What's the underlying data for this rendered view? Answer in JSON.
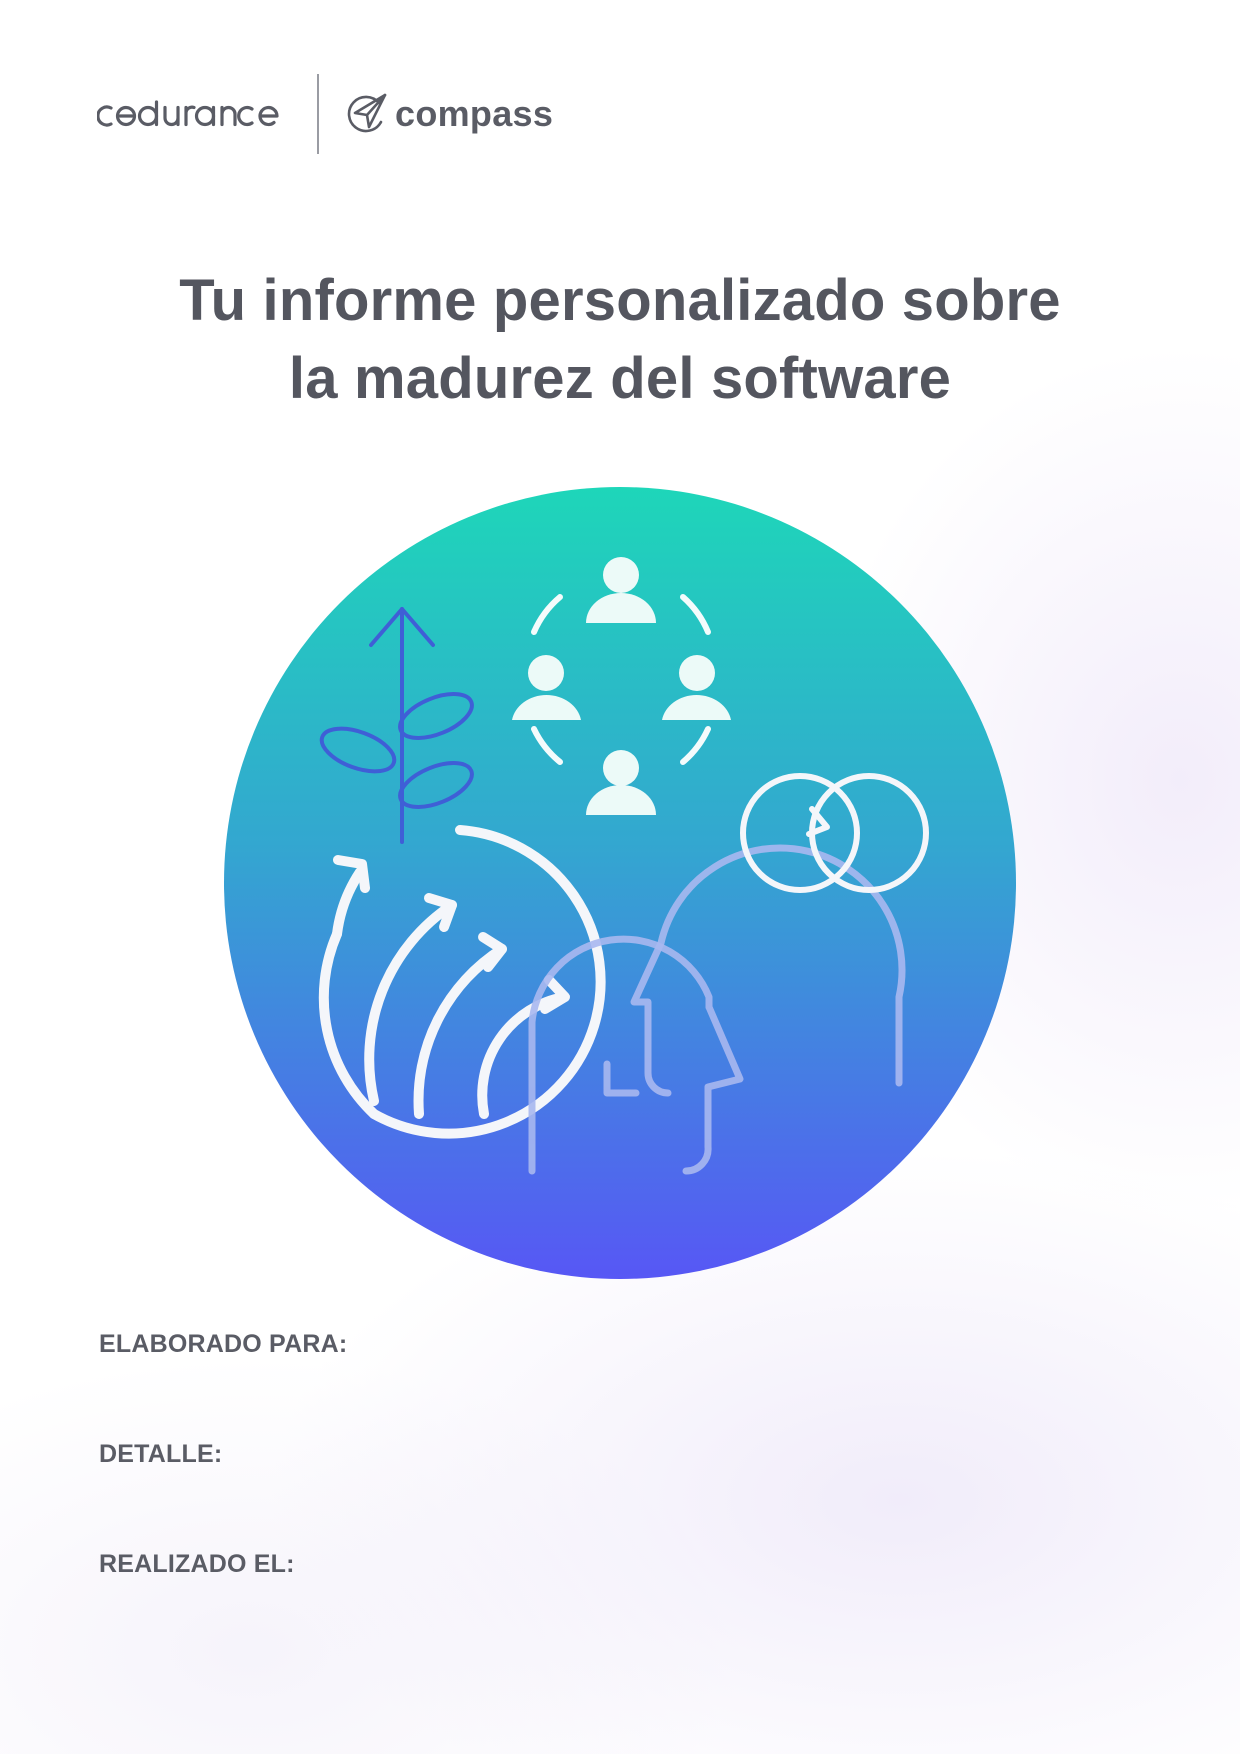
{
  "header": {
    "codurance_logo_text": "codurance",
    "compass_logo_text": "compass"
  },
  "title": {
    "line1": "Tu informe personalizado sobre",
    "line2": "la madurez del software"
  },
  "hero": {
    "icons": [
      "growth-arrow-icon",
      "team-circle-icon",
      "momentum-arrows-icon",
      "head-profile-icon",
      "cycle-icon"
    ],
    "gradient_top": "#1ed6b9",
    "gradient_bottom": "#5757f5"
  },
  "fields": {
    "prepared_for": "ELABORADO PARA:",
    "detail": "DETALLE:",
    "date": "REALIZADO EL:"
  },
  "colors": {
    "text": "#54565f",
    "accent_teal": "#1ed6b9",
    "accent_blue": "#5757f5"
  }
}
